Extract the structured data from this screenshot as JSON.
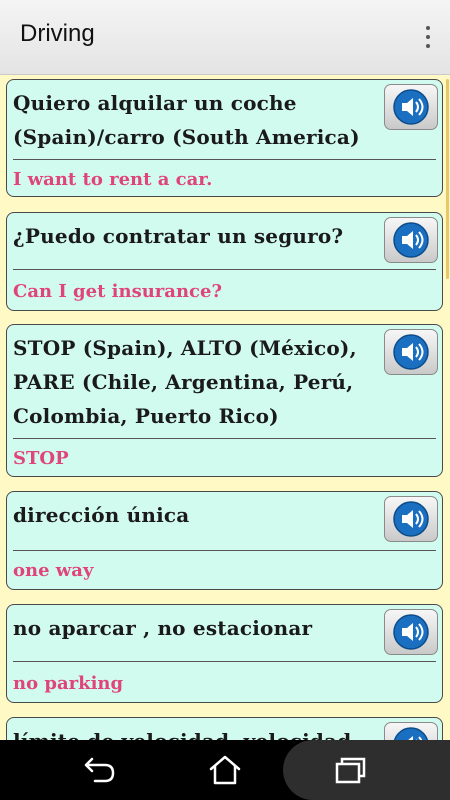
{
  "app": {
    "title": "Driving"
  },
  "phrases": [
    {
      "phrase": "Quiero alquilar un coche (Spain)/carro (South America)",
      "translation": "I want to rent a car."
    },
    {
      "phrase": "¿Puedo contratar un seguro?",
      "translation": "Can I get insurance?"
    },
    {
      "phrase": "STOP (Spain), ALTO (México), PARE (Chile, Argentina, Perú, Colombia, Puerto Rico)",
      "translation": "STOP"
    },
    {
      "phrase": "dirección única",
      "translation": "one way"
    },
    {
      "phrase": "no aparcar , no estacionar",
      "translation": "no parking"
    },
    {
      "phrase": "límite de velocidad, velocidad",
      "translation": ""
    }
  ],
  "icons": {
    "overflow": "more-vert-icon",
    "speak": "speaker-icon",
    "back": "back-icon",
    "home": "home-icon",
    "recents": "recents-icon"
  },
  "colors": {
    "background": "#fff9c6",
    "card": "#d2fbef",
    "translation": "#e0457a",
    "speaker_blue": "#1a6fc0"
  }
}
